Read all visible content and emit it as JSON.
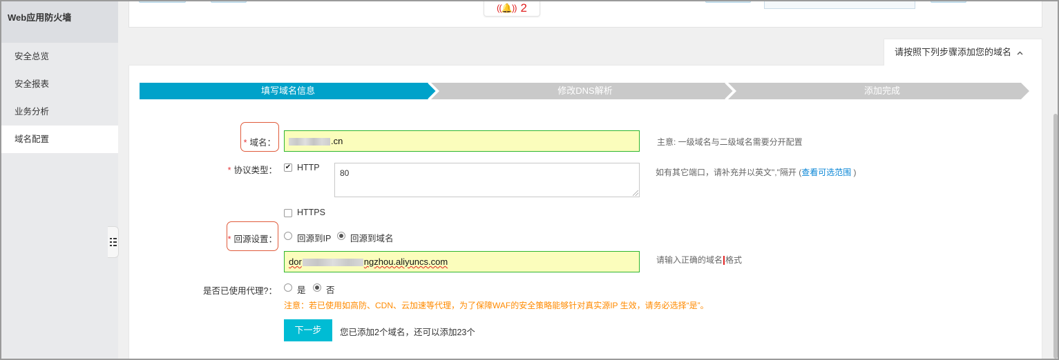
{
  "sidebar": {
    "title": "Web应用防火墙",
    "items": [
      {
        "label": "安全总览"
      },
      {
        "label": "安全报表"
      },
      {
        "label": "业务分析"
      },
      {
        "label": "域名配置"
      }
    ]
  },
  "top": {
    "alarm_count": "2"
  },
  "hint_tab": {
    "label": "请按照下列步骤添加您的域名",
    "chevron": "^"
  },
  "steps": [
    {
      "label": "填写域名信息"
    },
    {
      "label": "修改DNS解析"
    },
    {
      "label": "添加完成"
    }
  ],
  "form": {
    "domain": {
      "label": "域名：",
      "required_mark": "*",
      "value_suffix": ".cn",
      "help": "主意: 一级域名与二级域名需要分开配置"
    },
    "protocol": {
      "label": "协议类型：",
      "required_mark": "*",
      "http_label": "HTTP",
      "http_checked": true,
      "port_value": "80",
      "https_label": "HTTPS",
      "https_checked": false,
      "help_prefix": "如有其它端口，请补充并以英文\",\"隔开 (",
      "help_link": "查看可选范围",
      "help_suffix": " )"
    },
    "origin": {
      "label": "回源设置：",
      "required_mark": "*",
      "option_ip": "回源到IP",
      "option_domain": "回源到域名",
      "selected": "回源到域名",
      "value_prefix": "dor",
      "value_suffix": "ngzhou.aliyuncs.com",
      "help_before": "请输入正确的域名",
      "help_after": "格式"
    },
    "proxy": {
      "label": "是否已使用代理?：",
      "option_yes": "是",
      "option_no": "否",
      "selected": "否",
      "note": "注意：若已使用如高防、CDN、云加速等代理，为了保障WAF的安全策略能够针对真实源IP 生效，请务必选择“是”。"
    },
    "next_button": "下一步",
    "quota_text": "您已添加2个域名，还可以添加23个"
  },
  "colors": {
    "step_active": "#00a2ca",
    "step_inactive": "#c9c9c9",
    "accent_button": "#00bcd4",
    "required": "#e4393c",
    "note": "#ff8a00",
    "link": "#0a86d6",
    "input_highlight": "#fbfdbc",
    "input_border": "#2db52d",
    "annotation": "#e05a3a"
  },
  "icons": {
    "alarm": "bell-alarm-icon",
    "collapse": "collapse-sidebar-icon",
    "hint_chevron": "chevron-up-icon",
    "checkbox_checked": "check-icon"
  }
}
